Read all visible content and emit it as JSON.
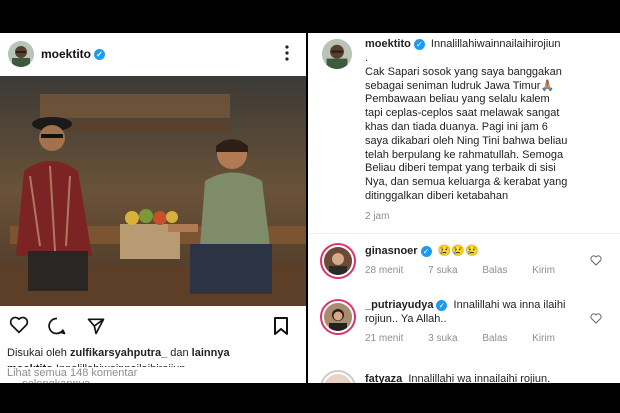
{
  "left_post": {
    "username": "moektito",
    "liked_by_prefix": "Disukai oleh",
    "liked_by_user": "zulfikarsyahputra_",
    "liked_by_suffix": "dan",
    "liked_by_others": "lainnya",
    "caption_user": "moektito",
    "caption_text": "Innalillahiwainnailaihirojiun",
    "more_prefix": "....",
    "more_label": "selengkapnya",
    "view_comments": "Lihat semua 148 komentar"
  },
  "right_post": {
    "username": "moektito",
    "first_line": "Innalillahiwainnailaihirojiun",
    "caption_lines": [
      ".",
      "Cak Sapari sosok yang saya banggakan",
      "sebagai seniman ludruk Jawa Timur🙏🏽",
      "Pembawaan beliau yang selalu kalem",
      "tapi ceplas-ceplos saat melawak sangat",
      "khas dan tiada duanya. Pagi ini jam 6",
      "saya dikabari oleh Ning Tini bahwa beliau",
      "telah berpulang ke rahmatullah. Semoga",
      "Beliau diberi tempat yang terbaik di sisi",
      "Nya, dan semua keluarga & kerabat yang",
      "ditinggalkan diberi ketabahan"
    ],
    "time": "2 jam",
    "comments": [
      {
        "user": "ginasnoer",
        "text": "😢😢😢",
        "time": "28 menit",
        "likes": "7 suka",
        "reply": "Balas",
        "send": "Kirim"
      },
      {
        "user": "_putriayudya",
        "text": "Innalillahi wa inna  ilaihi",
        "text2": "rojiun.. Ya Allah..",
        "time": "21 menit",
        "likes": "3 suka",
        "reply": "Balas",
        "send": "Kirim"
      },
      {
        "user": "fatyaza",
        "text": "Innalillahi wa innailaihi rojiun."
      }
    ]
  },
  "colors": {
    "verified": "#1d9bf0",
    "link_grey": "#8e8e8e",
    "story_ring": "#e1306c"
  }
}
